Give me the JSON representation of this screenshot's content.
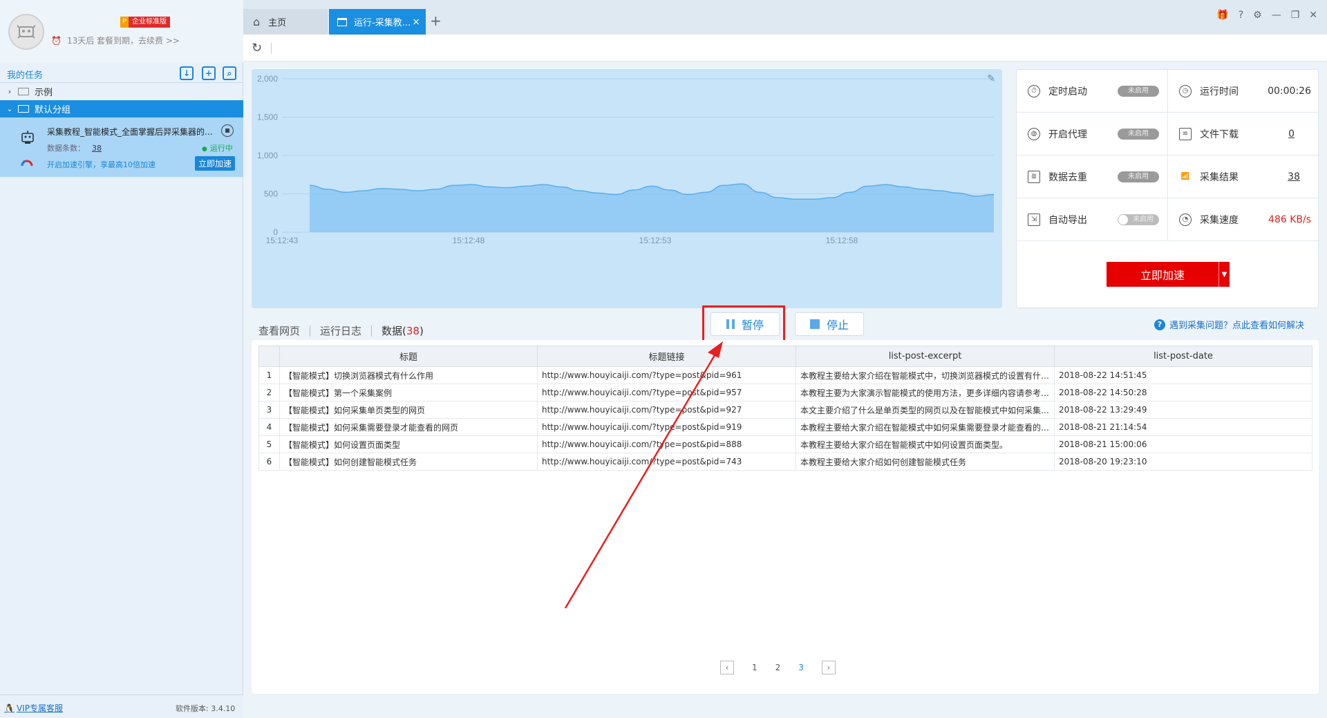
{
  "account": {
    "edition_prefix": "P",
    "edition": "企业标准版",
    "expire_text": "13天后 套餐到期，去续费 >>"
  },
  "sidebar": {
    "my_tasks_label": "我的任务",
    "groups": [
      {
        "label": "示例",
        "expanded": false
      },
      {
        "label": "默认分组",
        "expanded": true
      }
    ],
    "task": {
      "title": "采集教程_智能模式_全面掌握后羿采集器的...",
      "count_label": "数据条数：",
      "count": "38",
      "status": "运行中",
      "boost_hint": "开启加速引擎，享最高10倍加速",
      "boost_button": "立即加速"
    },
    "vip_service": "VIP专属客服",
    "version": "软件版本: 3.4.10"
  },
  "tabs": {
    "home": "主页",
    "active": "运行-采集教..."
  },
  "chart_data": {
    "type": "area",
    "ylim": [
      0,
      2000
    ],
    "y_ticks": [
      "2,000",
      "1,500",
      "1,000",
      "500",
      "0"
    ],
    "x_ticks": [
      "15:12:43",
      "15:12:48",
      "15:12:53",
      "15:12:58"
    ],
    "values": [
      610,
      560,
      520,
      540,
      570,
      560,
      540,
      560,
      610,
      620,
      590,
      580,
      600,
      620,
      590,
      540,
      510,
      490,
      550,
      600,
      550,
      490,
      520,
      610,
      630,
      520,
      450,
      430,
      430,
      450,
      520,
      600,
      620,
      590,
      560,
      540,
      510,
      470,
      490
    ]
  },
  "stats": {
    "schedule": {
      "label": "定时启动",
      "state": "未启用"
    },
    "runtime": {
      "label": "运行时间",
      "value": "00:00:26"
    },
    "proxy": {
      "label": "开启代理",
      "state": "未启用"
    },
    "download": {
      "label": "文件下载",
      "value": "0"
    },
    "dedup": {
      "label": "数据去重",
      "state": "未启用"
    },
    "results": {
      "label": "采集结果",
      "value": "38"
    },
    "export": {
      "label": "自动导出",
      "state": "未启用"
    },
    "speed": {
      "label": "采集速度",
      "value": "486 KB/s"
    },
    "boost": "立即加速"
  },
  "data_tabs": {
    "webpage": "查看网页",
    "log": "运行日志",
    "data": "数据(",
    "data_count": "38",
    "data_close": ")"
  },
  "controls": {
    "pause": "暂停",
    "stop": "停止",
    "help": "遇到采集问题？点此查看如何解决"
  },
  "table": {
    "columns": [
      "标题",
      "标题链接",
      "list-post-excerpt",
      "list-post-date"
    ],
    "rows": [
      {
        "idx": "1",
        "title": "【智能模式】切换浏览器模式有什么作用",
        "link": "http://www.houyicaiji.com/?type=post&pid=961",
        "excerpt": "本教程主要给大家介绍在智能模式中，切换浏览器模式的设置有什么作用。",
        "date": "2018-08-22 14:51:45"
      },
      {
        "idx": "2",
        "title": "【智能模式】第一个采集案例",
        "link": "http://www.houyicaiji.com/?type=post&pid=957",
        "excerpt": "本教程主要为大家演示智能模式的使用方法，更多详细内容请参考智能模式的其他教程。",
        "date": "2018-08-22 14:50:28"
      },
      {
        "idx": "3",
        "title": "【智能模式】如何采集单页类型的网页",
        "link": "http://www.houyicaiji.com/?type=post&pid=927",
        "excerpt": "本文主要介绍了什么是单页类型的网页以及在智能模式中如何采集单页类型的网页。",
        "date": "2018-08-22 13:29:49"
      },
      {
        "idx": "4",
        "title": "【智能模式】如何采集需要登录才能查看的网页",
        "link": "http://www.houyicaiji.com/?type=post&pid=919",
        "excerpt": "本教程主要给大家介绍在智能模式中如何采集需要登录才能查看的网页。",
        "date": "2018-08-21 21:14:54"
      },
      {
        "idx": "5",
        "title": "【智能模式】如何设置页面类型",
        "link": "http://www.houyicaiji.com/?type=post&pid=888",
        "excerpt": "本教程主要给大家介绍在智能模式中如何设置页面类型。",
        "date": "2018-08-21 15:00:06"
      },
      {
        "idx": "6",
        "title": "【智能模式】如何创建智能模式任务",
        "link": "http://www.houyicaiji.com/?type=post&pid=743",
        "excerpt": "本教程主要给大家介绍如何创建智能模式任务",
        "date": "2018-08-20 19:23:10"
      }
    ]
  },
  "pager": {
    "pages": [
      "1",
      "2",
      "3"
    ],
    "current": "3"
  },
  "colors": {
    "accent": "#1a8ee0",
    "danger": "#e60000",
    "chart_fill": "#8cc8f4",
    "chart_stroke": "#5aaee8",
    "annotation": "#e82020"
  },
  "icons": {
    "window_controls": [
      "gift-icon",
      "help-icon",
      "settings-icon",
      "minimize-icon",
      "restore-icon",
      "close-icon"
    ]
  }
}
